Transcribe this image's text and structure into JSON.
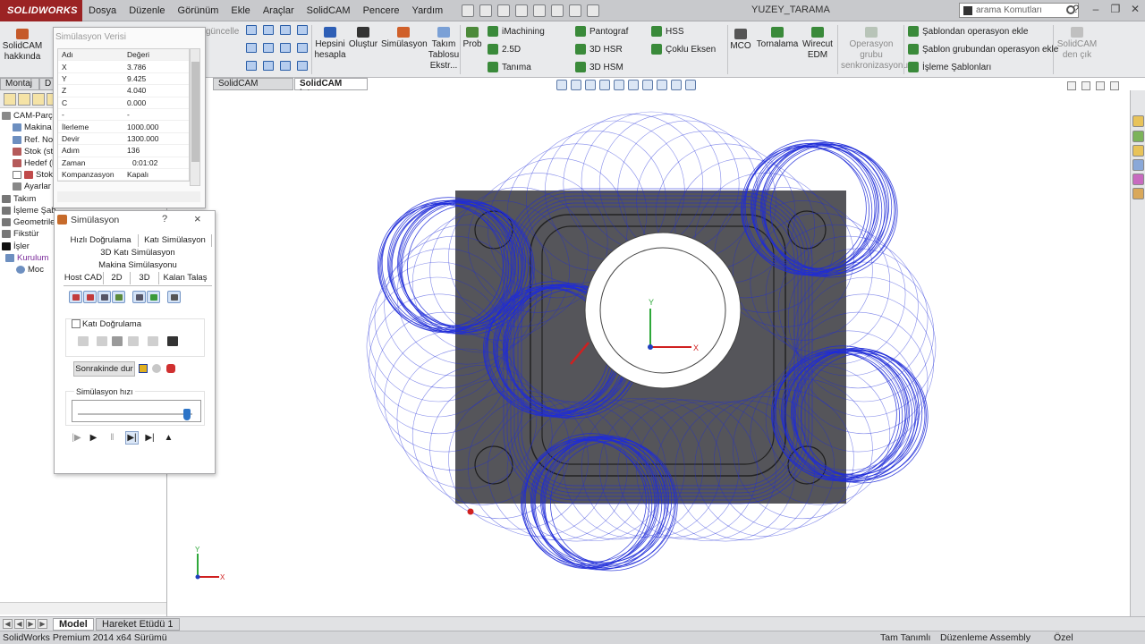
{
  "app": {
    "logo": "SOLIDWORKS",
    "menu": [
      "Dosya",
      "Düzenle",
      "Görünüm",
      "Ekle",
      "Araçlar",
      "SolidCAM",
      "Pencere",
      "Yardım"
    ],
    "doc_title": "YUZEY_TARAMA",
    "search_placeholder": "arama Komutları"
  },
  "ribbon": {
    "about": "SolidCAM hakkında",
    "update_partial": "güncelle",
    "calc_all": "Hepsini hesapla",
    "generate": "Oluştur",
    "simulation": "Simülasyon",
    "tool_table": "Takım Tablosu Ekstr...",
    "prob": "Prob",
    "imachining": "iMachining",
    "two_five_d": "2.5D",
    "definition": "Tanıma",
    "pantograph": "Pantograf",
    "hsr": "3D HSR",
    "hsm": "3D HSM",
    "hss": "HSS",
    "multi_axis": "Çoklu Eksen",
    "mco": "MCO",
    "turning": "Tornalama",
    "wire_edm": "Wirecut EDM",
    "op_group_sync": "Operasyon grubu senkronizasyonu",
    "add_from_template": "Şablondan operasyon ekle",
    "add_from_template_group": "Şablon grubundan operasyon ekle",
    "process_templates": "İşleme Şablonları",
    "exit_solidcam": "SolidCAM den çık"
  },
  "tabs": {
    "assembly": "Montaj",
    "d": "D",
    "solidcam_part": "SolidCAM Parçası",
    "solidcam_ops": "SolidCAM İşler"
  },
  "tree": [
    "CAM-Parça",
    "Makina",
    "Ref. Nok",
    "Stok (st",
    "Hedef (l",
    "Stok",
    "Ayarlar",
    "Takım",
    "İşleme Şab",
    "Geometriler",
    "Fikstür",
    "İşler",
    "Kurulum",
    "Moc"
  ],
  "sim_data": {
    "title": "Simülasyon Verisi",
    "headers": [
      "Adı",
      "Değeri"
    ],
    "rows": [
      [
        "X",
        "3.786"
      ],
      [
        "Y",
        "9.425"
      ],
      [
        "Z",
        "4.040"
      ],
      [
        "C",
        "0.000"
      ],
      [
        "-",
        "-"
      ],
      [
        "İlerleme",
        "1000.000"
      ],
      [
        "Devir",
        "1300.000"
      ],
      [
        "Adım",
        "136"
      ],
      [
        "Zaman",
        "0:01:02"
      ],
      [
        "Kompanzasyon",
        "Kapalı"
      ]
    ]
  },
  "sim_dialog": {
    "title": "Simülasyon",
    "help": "?",
    "close": "×",
    "tabs_row1": [
      "Hızlı Doğrulama",
      "Katı Simülasyon"
    ],
    "tab_3d_solid": "3D Katı Simülasyon",
    "tab_machine": "Makina Simülasyonu",
    "tabs_row4": [
      "Host CAD",
      "2D",
      "3D",
      "Kalan Talaş"
    ],
    "solid_verify": "Katı Doğrulama",
    "stop_next": "Sonrakinde dur",
    "speed_label": "Simülasyon hızı",
    "speed_value": 0.95
  },
  "bottom": {
    "model_tab": "Model",
    "motion_tab": "Hareket Etüdü 1"
  },
  "status": {
    "version": "SolidWorks Premium 2014 x64 Sürümü",
    "undefined": "Tam Tanımlı",
    "editing": "Düzenleme Assembly",
    "custom": "Özel"
  },
  "viewport": {
    "axis_x": "X",
    "axis_y": "Y"
  },
  "colors": {
    "toolpath": "#1f2bd8",
    "stock": "#55555a",
    "brand": "#9b2324"
  }
}
